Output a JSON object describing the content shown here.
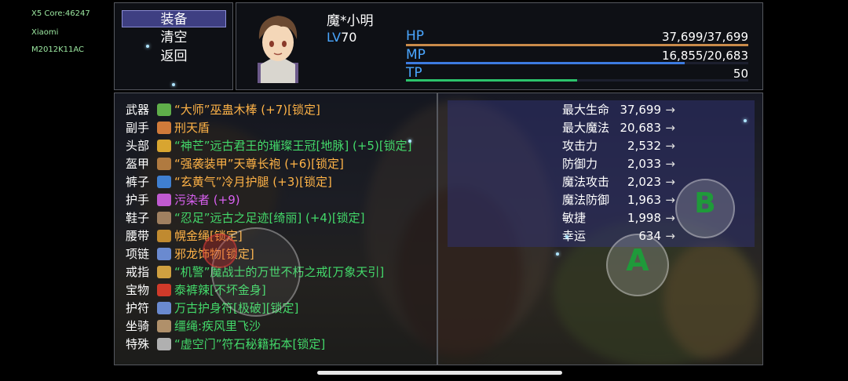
{
  "debug": [
    "X5 Core:46247",
    "Xiaomi",
    "M2012K11AC"
  ],
  "menu": [
    {
      "label": "装备",
      "selected": true
    },
    {
      "label": "清空",
      "selected": false
    },
    {
      "label": "返回",
      "selected": false
    }
  ],
  "character": {
    "name": "魔*小明",
    "level_prefix": "LV",
    "level": "70",
    "hp": {
      "label": "HP",
      "value": "37,699/37,699",
      "fraction": 1.0,
      "color": "#c98b4a"
    },
    "mp": {
      "label": "MP",
      "value": "16,855/20,683",
      "fraction": 0.815,
      "color": "#3d7be0"
    },
    "tp": {
      "label": "TP",
      "value": "50",
      "fraction": 0.5,
      "color": "#2cc36b"
    }
  },
  "equipment": [
    {
      "slot": "武器",
      "item": "“大师”巫蛊木棒 (+7)[锁定]",
      "color": "#ffb347",
      "icon": "#5fae4a"
    },
    {
      "slot": "副手",
      "item": "刑天盾",
      "color": "#ffb347",
      "icon": "#d07a3a"
    },
    {
      "slot": "头部",
      "item": "“神芒”远古君王的璀璨王冠[地脉] (+5)[锁定]",
      "color": "#43d96a",
      "icon": "#d8a530"
    },
    {
      "slot": "盔甲",
      "item": "“强袭装甲”天尊长袍 (+6)[锁定]",
      "color": "#ffb347",
      "icon": "#b07a40"
    },
    {
      "slot": "裤子",
      "item": "“玄黄气”冷月护腿 (+3)[锁定]",
      "color": "#ffb347",
      "icon": "#3f7fd0"
    },
    {
      "slot": "护手",
      "item": "污染者 (+9)",
      "color": "#d860f0",
      "icon": "#c05ad0"
    },
    {
      "slot": "鞋子",
      "item": "“忍足”远古之足迹[绮丽] (+4)[锁定]",
      "color": "#43d96a",
      "icon": "#a08060"
    },
    {
      "slot": "腰带",
      "item": "幌金绳[锁定]",
      "color": "#ffb347",
      "icon": "#c08a30"
    },
    {
      "slot": "项链",
      "item": "邪龙饰物[锁定]",
      "color": "#ffb347",
      "icon": "#6a8ad0"
    },
    {
      "slot": "戒指",
      "item": "“机警”魔战士的万世不朽之戒[万象天引]",
      "color": "#43d96a",
      "icon": "#d0a040"
    },
    {
      "slot": "宝物",
      "item": "泰裤辣[不坏金身]",
      "color": "#43d96a",
      "icon": "#d03a2a"
    },
    {
      "slot": "护符",
      "item": "万古护身符[极破][锁定]",
      "color": "#43d96a",
      "icon": "#6a8ad0"
    },
    {
      "slot": "坐骑",
      "item": "缰绳:疾风里飞沙",
      "color": "#43d96a",
      "icon": "#b0906a"
    },
    {
      "slot": "特殊",
      "item": "“虚空门”符石秘籍拓本[锁定]",
      "color": "#43d96a",
      "icon": "#b0b0b0"
    }
  ],
  "stats": [
    {
      "name": "最大生命",
      "value": "37,699",
      "arrow": "→"
    },
    {
      "name": "最大魔法",
      "value": "20,683",
      "arrow": "→"
    },
    {
      "name": "攻击力",
      "value": "2,532",
      "arrow": "→"
    },
    {
      "name": "防御力",
      "value": "2,033",
      "arrow": "→"
    },
    {
      "name": "魔法攻击",
      "value": "2,023",
      "arrow": "→"
    },
    {
      "name": "魔法防御",
      "value": "1,963",
      "arrow": "→"
    },
    {
      "name": "敏捷",
      "value": "1,998",
      "arrow": "→"
    },
    {
      "name": "幸运",
      "value": "634",
      "arrow": "→"
    }
  ],
  "buttons": {
    "a": "A",
    "b": "B"
  }
}
